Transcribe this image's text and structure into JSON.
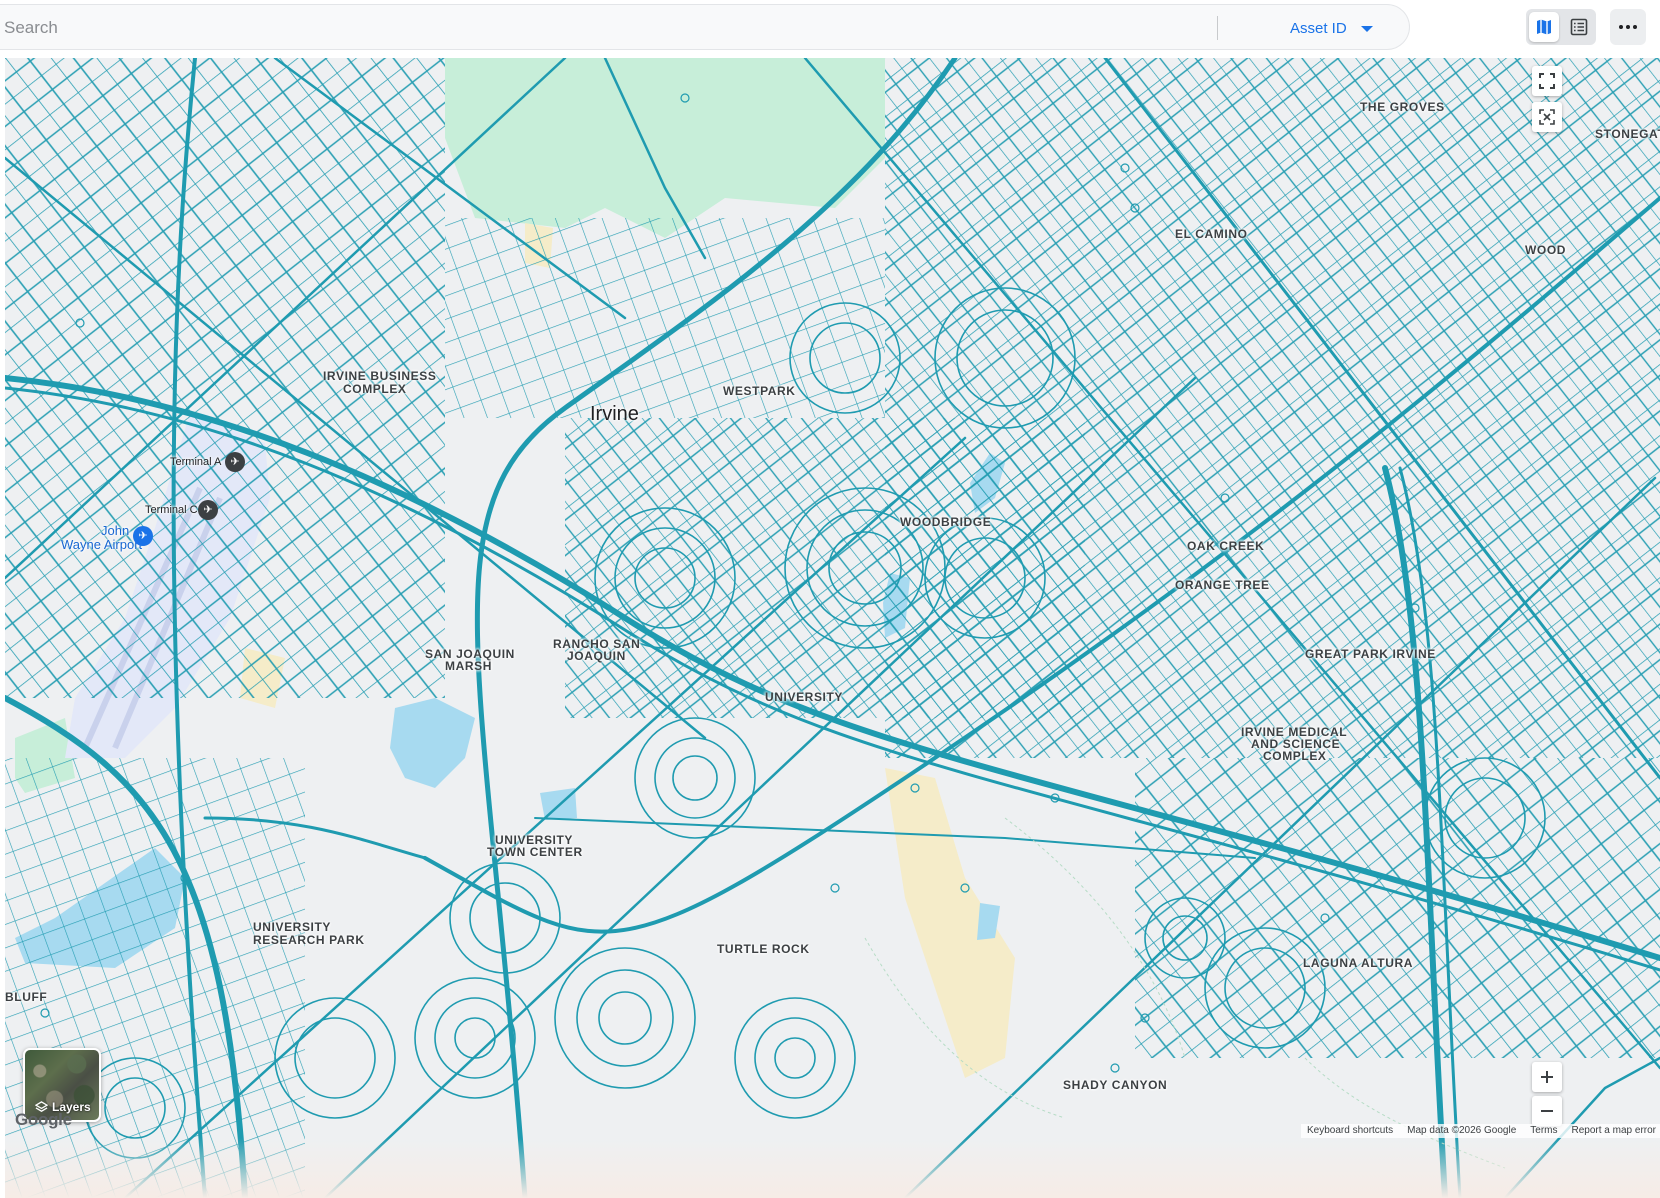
{
  "toolbar": {
    "search_placeholder": "Search",
    "field_select_label": "Asset ID",
    "view_modes": [
      "map-view",
      "list-view"
    ],
    "active_view": "map-view"
  },
  "map": {
    "road_color": "#1f9bb0",
    "labels": {
      "the_groves": "THE GROVES",
      "wood": "WOOD",
      "irvine_business_complex_1": "IRVINE BUSINESS",
      "irvine_business_complex_2": "COMPLEX",
      "irvine": "Irvine",
      "westpark": "WESTPARK",
      "terminal_a": "Terminal A",
      "terminal_c": "Terminal C",
      "john_wayne_1": "John",
      "john_wayne_2": "Wayne Airport",
      "san_joaquin_marsh_1": "SAN JOAQUIN",
      "san_joaquin_marsh_2": "MARSH",
      "rancho_san_joaquin_1": "RANCHO SAN",
      "rancho_san_joaquin_2": "JOAQUIN",
      "university_park": "UNIVERSITY",
      "oak_creek": "OAK CREEK",
      "orange_tree": "ORANGE TREE",
      "great_park_irvine": "GREAT PARK IRVINE",
      "medical_complex_1": "IRVINE MEDICAL",
      "medical_complex_2": "AND SCIENCE",
      "medical_complex_3": "COMPLEX",
      "university_town_center_1": "UNIVERSITY",
      "university_town_center_2": "TOWN CENTER",
      "research_park_1": "UNIVERSITY",
      "research_park_2": "RESEARCH PARK",
      "turtle_rock": "TURTLE ROCK",
      "laguna_altura": "LAGUNA ALTURA",
      "bluff": "BLUFF",
      "shady_canyon": "SHADY CANYON",
      "woodbridge": "WOODBRIDGE",
      "el_camino": "EL CAMINO",
      "stonegate": "STONEGATE"
    },
    "layers_label": "Layers",
    "google_logo": "Google",
    "attribution": {
      "keyboard": "Keyboard shortcuts",
      "map_data": "Map data ©2026 Google",
      "terms": "Terms",
      "report": "Report a map error"
    },
    "icons": {
      "fullscreen": "fullscreen-icon",
      "fit_bounds": "fit-bounds-icon",
      "zoom_in": "plus-icon",
      "zoom_out": "minus-icon"
    }
  }
}
